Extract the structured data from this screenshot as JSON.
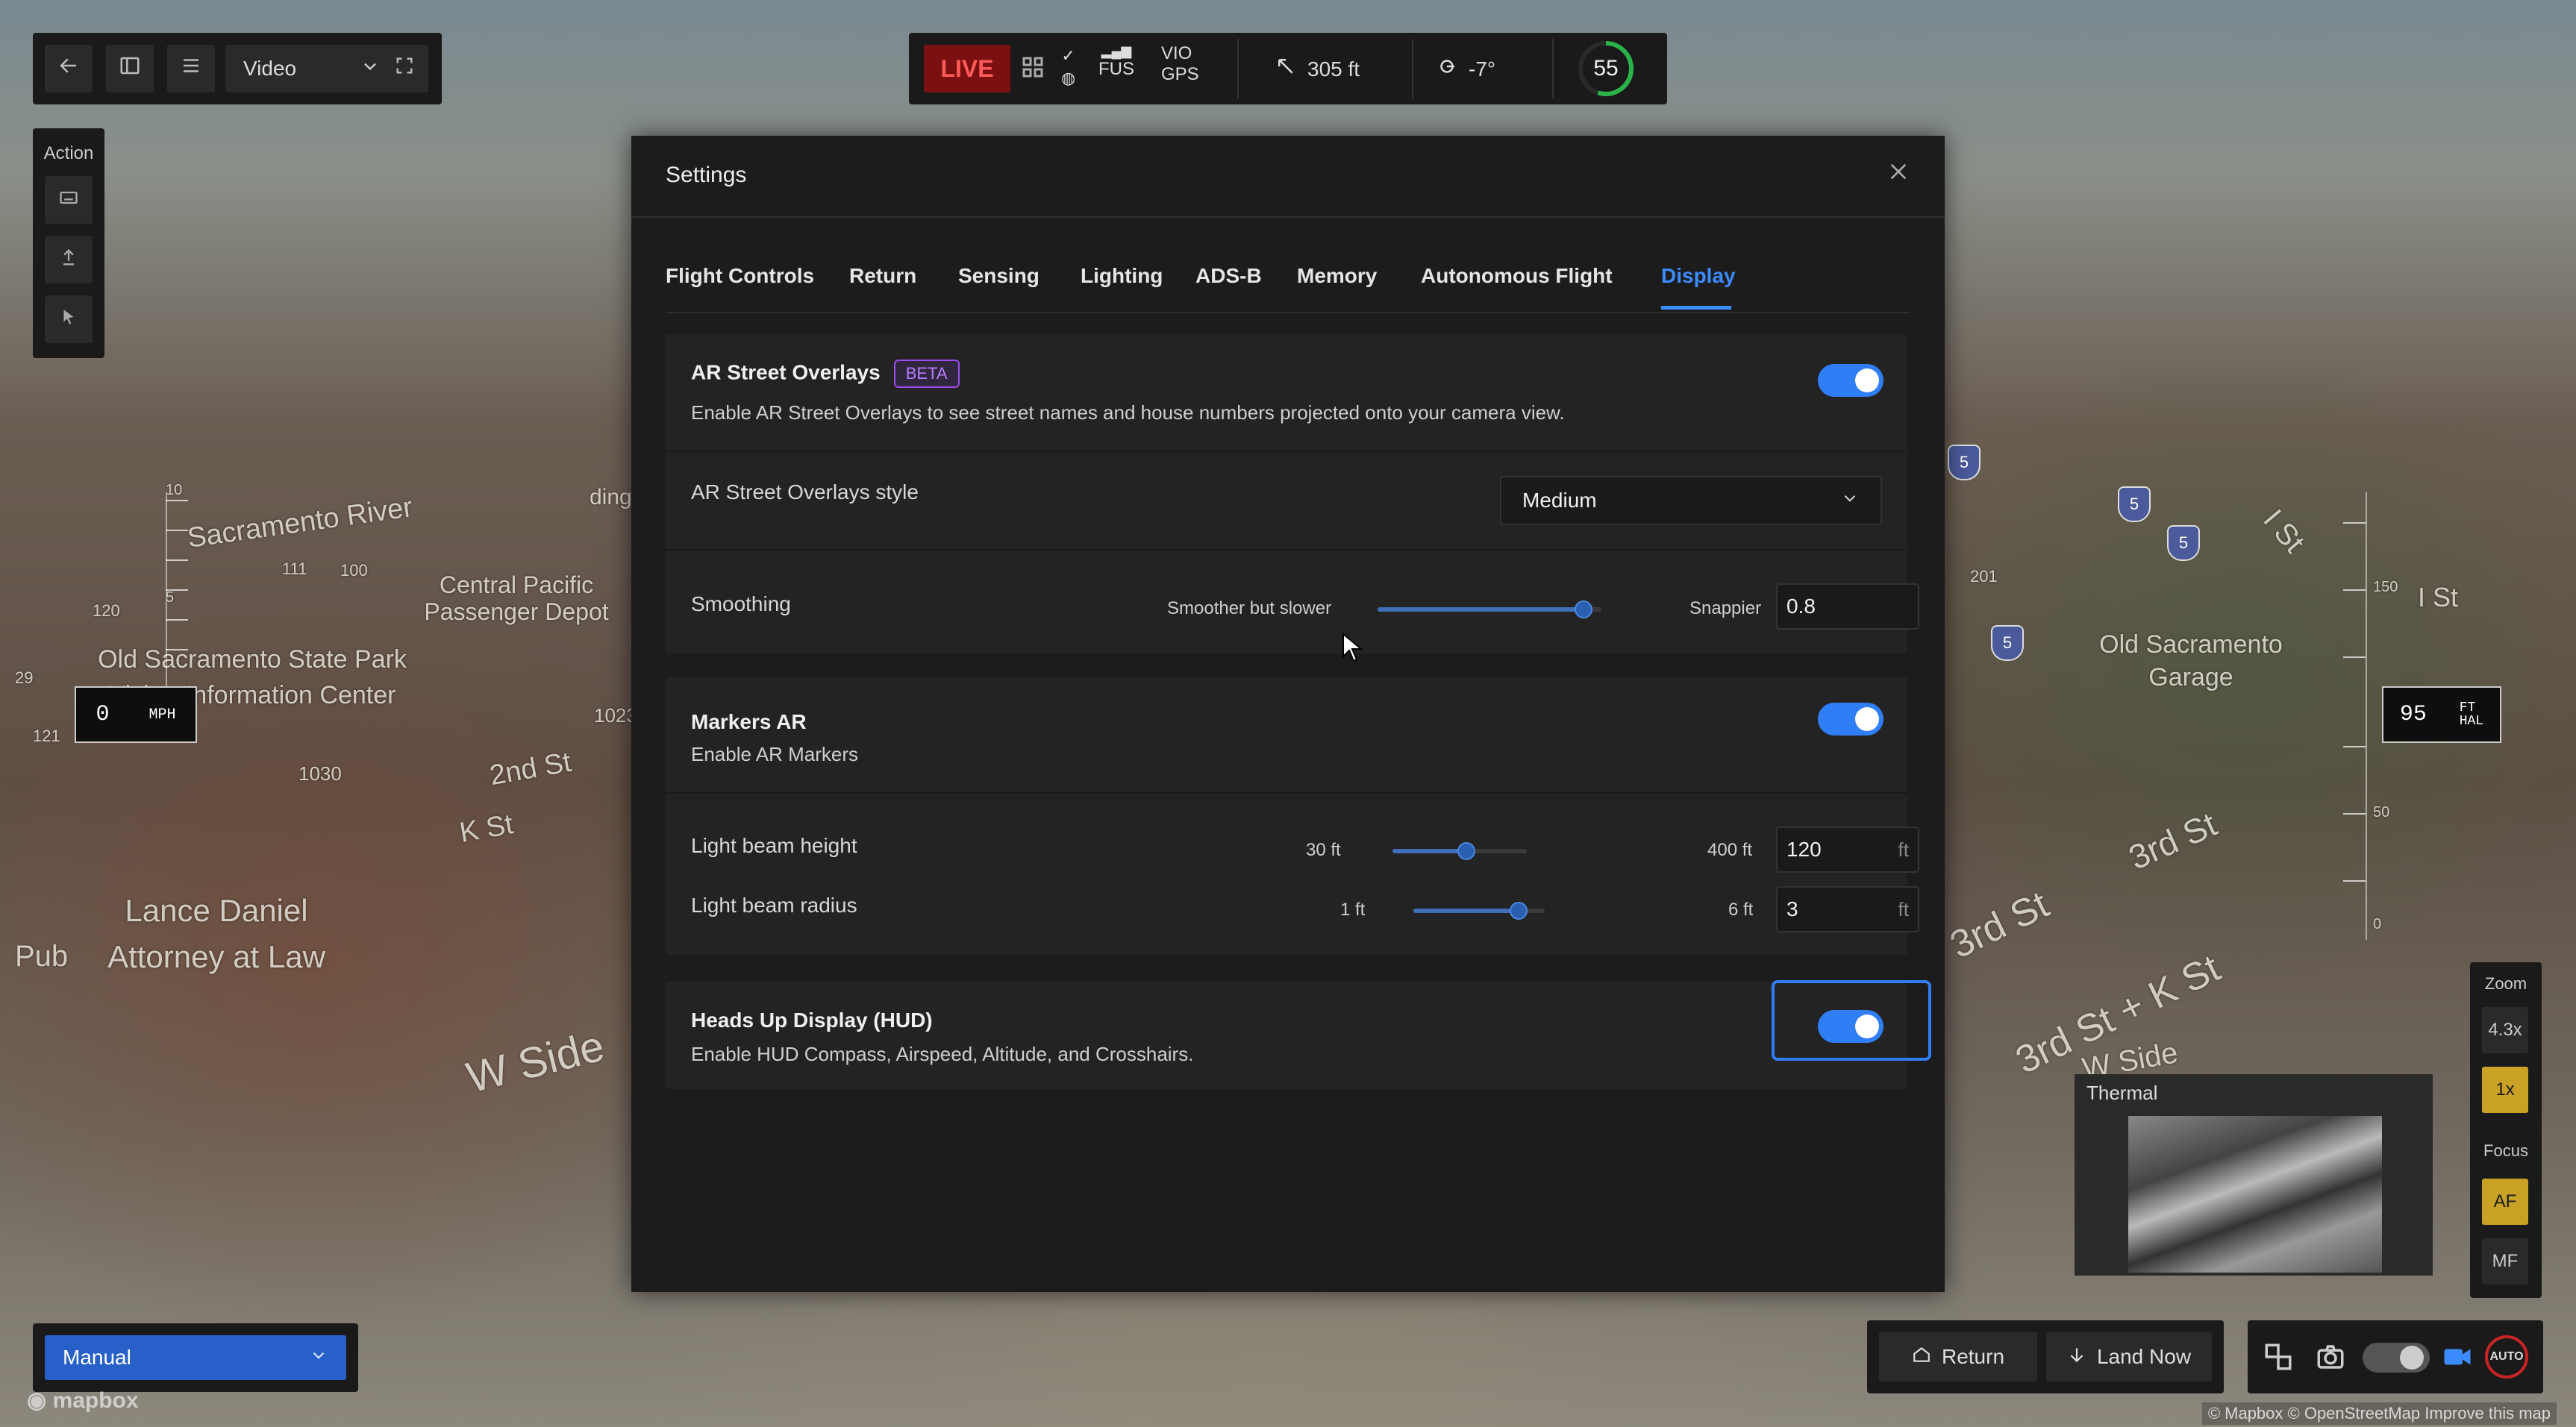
{
  "toolbar": {
    "view_mode": "Video"
  },
  "action_bar": {
    "title": "Action"
  },
  "status": {
    "live_label": "LIVE",
    "fus_label": "FUS",
    "vio_label": "VIO",
    "gps_label": "GPS",
    "distance": "305 ft",
    "pitch": "-7°",
    "battery": "55",
    "battery_color": "#2bb34a"
  },
  "map": {
    "labels": [
      "Sacramento River",
      "Central Pacific Passenger Depot",
      "Old Sacramento State Park Visitor Information Center",
      "2nd St",
      "K St",
      "Lance Daniel Attorney at Law",
      "W Side",
      "Old Sacramento Garage",
      "3rd St",
      "3rd St",
      "3rd St + K St",
      "W Side",
      "I St",
      "I St",
      "ding",
      "Pub"
    ],
    "numbers": [
      "111",
      "100",
      "120",
      "1030",
      "1023",
      "121",
      "29",
      "201"
    ],
    "route_shields": [
      "5",
      "5",
      "5",
      "5"
    ]
  },
  "speed": {
    "value": "0",
    "unit": "MPH",
    "scale": [
      "10",
      "5"
    ]
  },
  "altitude": {
    "value": "95",
    "unit_top": "FT",
    "unit_bottom": "HAL",
    "scale": [
      "150",
      "50",
      "0"
    ]
  },
  "settings": {
    "title": "Settings",
    "tabs": [
      {
        "label": "Flight Controls"
      },
      {
        "label": "Return"
      },
      {
        "label": "Sensing"
      },
      {
        "label": "Lighting"
      },
      {
        "label": "ADS-B"
      },
      {
        "label": "Memory"
      },
      {
        "label": "Autonomous Flight"
      },
      {
        "label": "Display"
      }
    ],
    "active_tab": "Display",
    "ar_street": {
      "title": "AR Street Overlays",
      "badge": "BETA",
      "desc": "Enable AR Street Overlays to see street names and house numbers projected onto your camera view.",
      "enabled": true,
      "style_label": "AR Street Overlays style",
      "style_value": "Medium",
      "smoothing_label": "Smoothing",
      "smoothing_min": "Smoother but slower",
      "smoothing_max": "Snappier",
      "smoothing_value": "0.8",
      "smoothing_fraction": 0.92
    },
    "markers": {
      "title": "Markers AR",
      "desc": "Enable AR Markers",
      "enabled": true,
      "beam_height_label": "Light beam height",
      "beam_height_min": "30 ft",
      "beam_height_max": "400 ft",
      "beam_height_value": "120",
      "beam_height_unit": "ft",
      "beam_height_fraction": 0.55,
      "beam_radius_label": "Light beam radius",
      "beam_radius_min": "1 ft",
      "beam_radius_max": "6 ft",
      "beam_radius_value": "3",
      "beam_radius_unit": "ft",
      "beam_radius_fraction": 0.8
    },
    "hud": {
      "title": "Heads Up Display (HUD)",
      "desc": "Enable HUD Compass, Airspeed, Altitude, and Crosshairs.",
      "enabled": true
    }
  },
  "zoom": {
    "title": "Zoom",
    "max": "4.3x",
    "current": "1x",
    "focus_title": "Focus",
    "af": "AF",
    "mf": "MF"
  },
  "thermal": {
    "label": "Thermal"
  },
  "flight_mode": {
    "value": "Manual"
  },
  "actions": {
    "return_label": "Return",
    "land_label": "Land Now"
  },
  "camera": {
    "auto_label": "AUTO"
  },
  "footer": {
    "mapbox": "mapbox",
    "credits": "© Mapbox © OpenStreetMap Improve this map"
  }
}
